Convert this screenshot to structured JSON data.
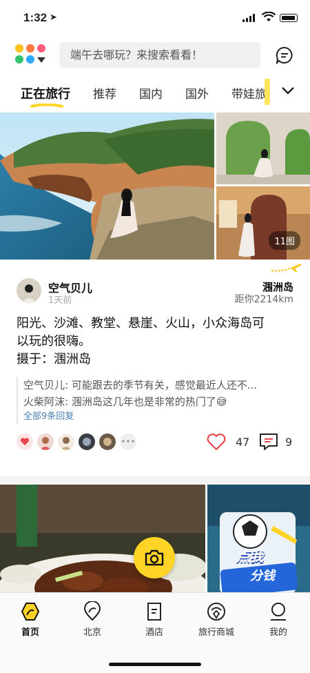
{
  "status": {
    "time": "1:32"
  },
  "search": {
    "placeholder": "端午去哪玩？来搜索看看！"
  },
  "tabs": [
    {
      "label": "正在旅行",
      "active": true
    },
    {
      "label": "推荐"
    },
    {
      "label": "国内"
    },
    {
      "label": "国外"
    },
    {
      "label": "带娃旅"
    }
  ],
  "post": {
    "photo_count": "11图",
    "user": "空气贝儿",
    "posted": "1天前",
    "place": "涠洲岛",
    "distance": "距你2214km",
    "text_line1": "阳光、沙滩、教堂、悬崖、火山，小众海岛可",
    "text_line2": "以玩的很嗨。",
    "text_line3": "摄于：涠洲岛",
    "comments": [
      "空气贝儿: 可能跟去的季节有关，感觉最近人还不...",
      "火柴阿沫: 涠洲岛这几年也是非常的热门了😅"
    ],
    "all_replies": "全部9条回复",
    "likes": "47",
    "comment_count": "9"
  },
  "promo": {
    "line1": "点我",
    "line2": "分钱"
  },
  "nav": [
    {
      "label": "首页",
      "icon": "home-icon",
      "active": true
    },
    {
      "label": "北京",
      "icon": "location-icon"
    },
    {
      "label": "酒店",
      "icon": "hotel-icon"
    },
    {
      "label": "旅行商城",
      "icon": "mall-icon"
    },
    {
      "label": "我的",
      "icon": "profile-icon"
    }
  ],
  "colors": {
    "accent": "#ffd426",
    "like_red": "#e8454a",
    "link_blue": "#4a7fb5"
  }
}
